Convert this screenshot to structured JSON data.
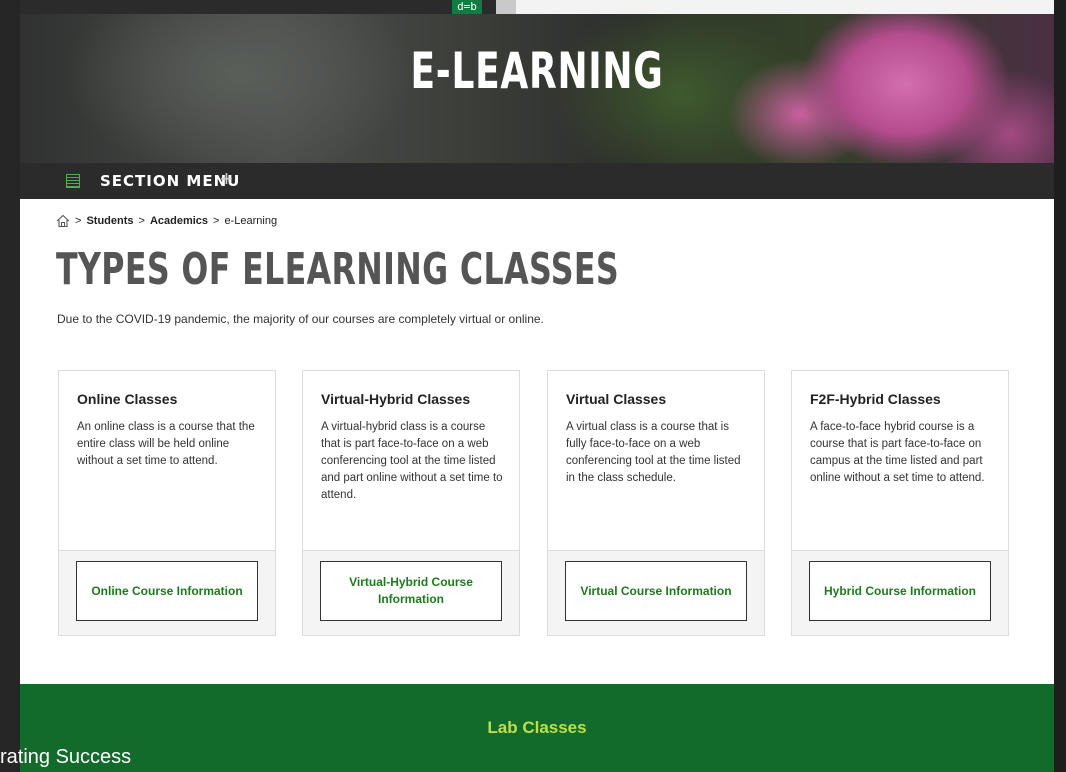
{
  "hero": {
    "title": "E-LEARNING"
  },
  "topbar": {
    "app_icon_glyph": "d=b"
  },
  "section_menu": {
    "label": "SECTION MENU",
    "plus": "+"
  },
  "breadcrumb": {
    "home_icon": "home-icon",
    "separator": ">",
    "items": [
      "Students",
      "Academics",
      "e-Learning"
    ]
  },
  "main": {
    "title": "TYPES OF ELEARNING CLASSES",
    "subtitle": "Due to the COVID-19 pandemic, the majority of our courses are completely virtual or online."
  },
  "cards": [
    {
      "title": "Online Classes",
      "body": "An online class is a course that the entire class will be held online without a set time to attend.",
      "button": "Online Course Information"
    },
    {
      "title": "Virtual-Hybrid Classes",
      "body": "A virtual-hybrid class is a course that is part face-to-face on a web conferencing tool at the time listed and part online without a set time to attend.",
      "button": "Virtual-Hybrid Course Information"
    },
    {
      "title": "Virtual Classes",
      "body": "A virtual class is a course that is fully face-to-face on a web conferencing tool at the time listed in the class schedule.",
      "button": "Virtual Course Information"
    },
    {
      "title": "F2F-Hybrid Classes",
      "body": "A face-to-face hybrid course is a course that is part face-to-face on campus at the time listed and part online without a set time to attend.",
      "button": "Hybrid Course Information"
    }
  ],
  "lab": {
    "title": "Lab Classes"
  },
  "overlay": {
    "text": "rating Success"
  },
  "colors": {
    "accent_green": "#1f7a1f",
    "band_green": "#126b2a",
    "lab_title": "#b9e04a",
    "dark_bar": "#2b2b2b"
  }
}
